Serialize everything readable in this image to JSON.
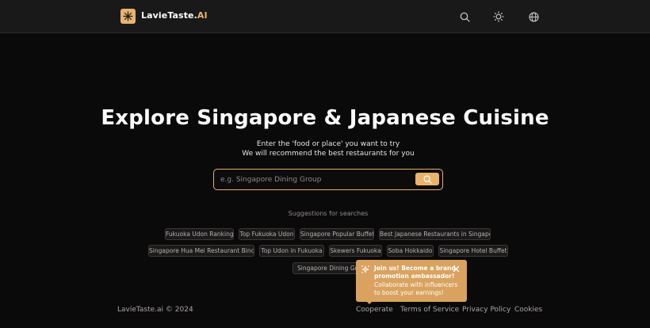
{
  "header": {
    "brand_main": "LavieTaste.",
    "brand_accent": "AI",
    "icons": [
      "search-icon",
      "sun-icon",
      "globe-icon"
    ]
  },
  "hero": {
    "title": "Explore Singapore & Japanese Cuisine",
    "subtitle_line1": "Enter the 'food or place' you want to try",
    "subtitle_line2": "We will recommend the best restaurants for you"
  },
  "search": {
    "placeholder": "e.g. Singapore Dining Group",
    "value": ""
  },
  "suggestions": {
    "label": "Suggestions for searches",
    "row1": [
      "Fukuoka Udon Ranking",
      "Top Fukuoka Udon",
      "Singapore Popular Buffet",
      "Best Japanese Restaurants in Singapore"
    ],
    "row2": [
      "Singapore Hua Mei Restaurant Bincho",
      "Top Udon  in Fukuoka",
      "Skewers Fukuoka",
      "Soba Hokkaido",
      "Singapore Hotel Buffet"
    ],
    "row3": [
      "Singapore Dining Group"
    ]
  },
  "popup": {
    "title": "Join us! Become a brand promotion ambassador!",
    "body": "Collaborate with influencers to boost your earnings!"
  },
  "footer": {
    "copyright": "LavieTaste.ai © 2024",
    "links": [
      "Cooperate",
      "Terms of Service",
      "Privacy Policy",
      "Cookies"
    ]
  },
  "colors": {
    "accent": "#e9b36d",
    "background": "#0b0a0b",
    "header_bg": "#1a191a",
    "popup_bg": "#d9a25e"
  }
}
